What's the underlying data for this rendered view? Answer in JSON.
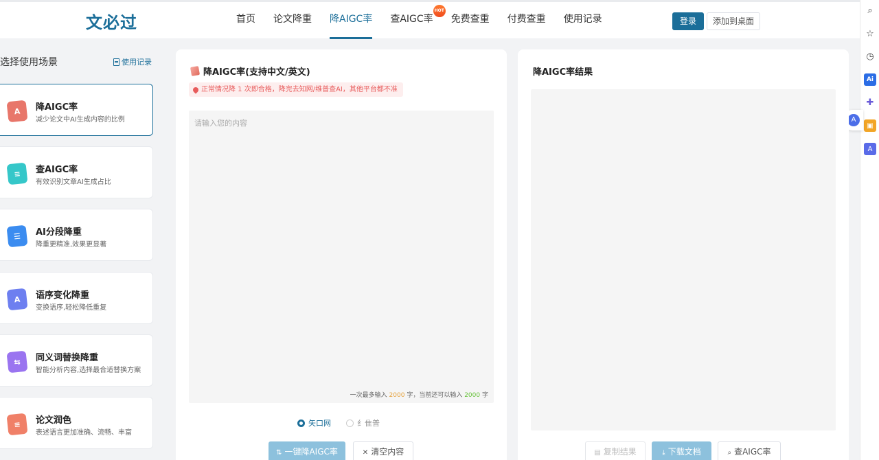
{
  "header": {
    "logo": "文必过",
    "nav": [
      {
        "label": "首页"
      },
      {
        "label": "论文降重"
      },
      {
        "label": "降AIGC率",
        "active": true
      },
      {
        "label": "查AIGC率",
        "badge": "HOT"
      },
      {
        "label": "免费查重"
      },
      {
        "label": "付费查重"
      },
      {
        "label": "使用记录"
      }
    ],
    "login_label": "登录",
    "add_desktop_label": "添加到桌面"
  },
  "sidebar": {
    "title": "选择使用场景",
    "history_label": "使用记录",
    "scenes": [
      {
        "name": "降AIGC率",
        "desc": "减少论文中AI生成内容的比例",
        "icon_text": "A",
        "color": "#e8766a",
        "active": true
      },
      {
        "name": "查AIGC率",
        "desc": "有效识别文章AI生成占比",
        "icon_text": "≡",
        "color": "#35c7c9"
      },
      {
        "name": "AI分段降重",
        "desc": "降重更精准,效果更显著",
        "icon_text": "☰",
        "color": "#3b8cf0"
      },
      {
        "name": "语序变化降重",
        "desc": "变换语序,轻松降低重复",
        "icon_text": "A",
        "color": "#6d7ff0"
      },
      {
        "name": "同义词替换降重",
        "desc": "智能分析内容,选择最合适替换方案",
        "icon_text": "⇆",
        "color": "#9a74f0"
      },
      {
        "name": "论文润色",
        "desc": "表述语言更加准确、流畅、丰富",
        "icon_text": "≡",
        "color": "#f08068"
      }
    ]
  },
  "input_panel": {
    "title": "降AIGC率(支持中文/英文)",
    "notice": "正常情况降 1 次即合格，降完去知网/维普查AI，其他平台都不准",
    "placeholder": "请输入您的内容",
    "counter_prefix": "一次最多输入",
    "max_chars": "2000",
    "counter_mid": "字，当前还可以输入",
    "remaining_chars": "2000",
    "counter_suffix": "字",
    "options": [
      {
        "label": "矢口网",
        "checked": true
      },
      {
        "label": "纟隹普",
        "checked": false
      }
    ],
    "reduce_button": "一键降AIGC率",
    "clear_button": "清空内容"
  },
  "result_panel": {
    "title": "降AIGC率结果",
    "copy_button": "复制结果",
    "download_button": "下载文档",
    "check_button": "查AIGC率"
  }
}
